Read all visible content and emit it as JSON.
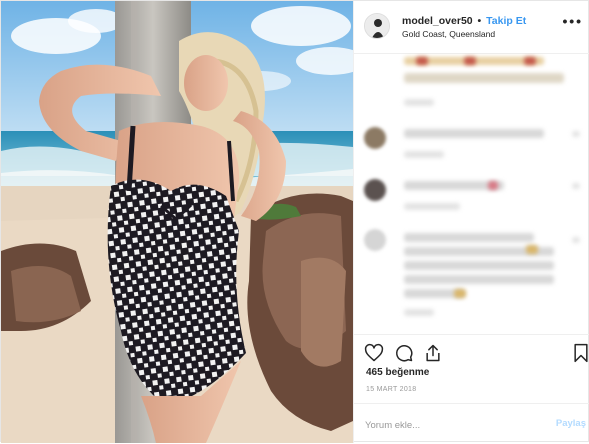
{
  "post": {
    "username": "model_over50",
    "separator": "•",
    "follow_label": "Takip Et",
    "location": "Gold Coast, Queensland",
    "more_icon": "more-options-icon",
    "likes": "465 beğenme",
    "date": "15 MART 2018",
    "comment_placeholder": "Yorum ekle...",
    "share_label": "Paylaş"
  },
  "icons": [
    "heart-icon",
    "comment-icon",
    "share-icon",
    "bookmark-icon"
  ],
  "colors": {
    "accent": "#3897f0",
    "share_disabled": "#b3dbff",
    "text": "#262626",
    "muted": "#999999",
    "border": "#efefef"
  }
}
